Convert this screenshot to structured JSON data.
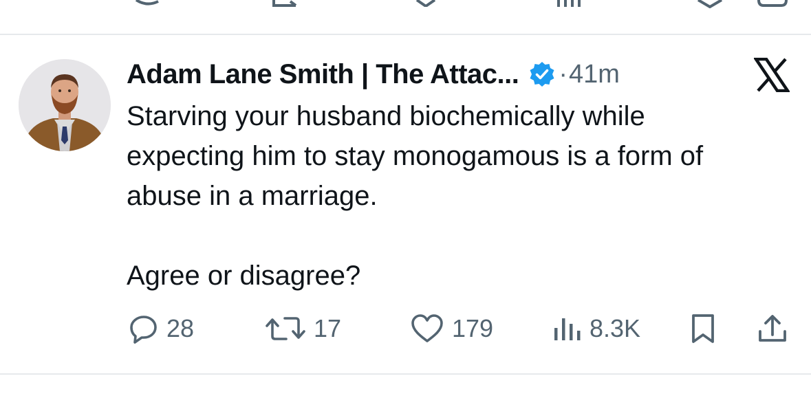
{
  "tweet": {
    "author_name": "Adam Lane Smith | The Attac...",
    "verified": true,
    "separator": "·",
    "time": "41m",
    "text_lines": [
      "Starving your husband biochemically while",
      "expecting him to stay monogamous is a form of",
      "abuse in a marriage."
    ],
    "text_question": "Agree or disagree?",
    "actions": {
      "replies": "28",
      "reposts": "17",
      "likes": "179",
      "views": "8.3K"
    }
  },
  "icons": {
    "verified": "verified-badge-icon",
    "platform": "x-logo-icon",
    "reply": "reply-icon",
    "repost": "repost-icon",
    "like": "heart-icon",
    "views": "views-chart-icon",
    "bookmark": "bookmark-icon",
    "share": "share-icon"
  },
  "colors": {
    "text_primary": "#0f1419",
    "text_secondary": "#536471",
    "verified_blue": "#1d9bf0",
    "divider": "#e6e9ec"
  }
}
